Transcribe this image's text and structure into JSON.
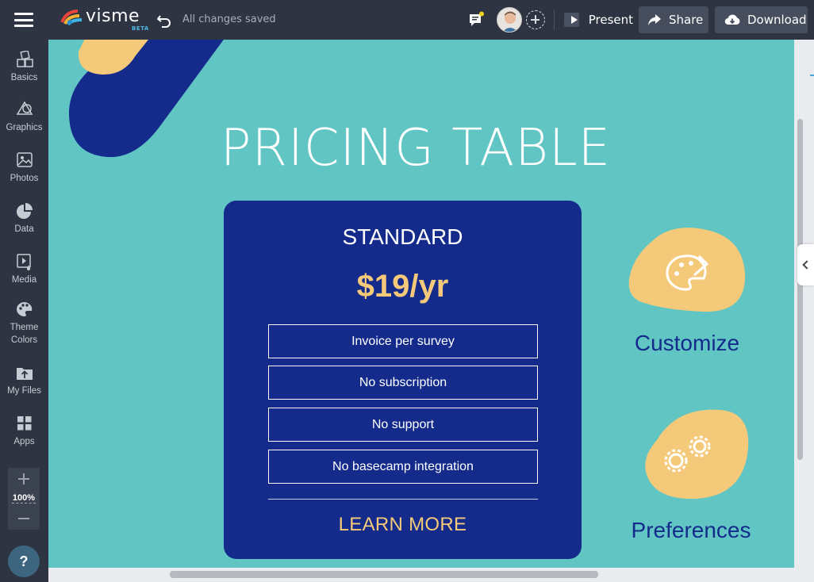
{
  "app": {
    "logo_text": "visme",
    "logo_badge": "BETA",
    "save_status": "All changes saved"
  },
  "header": {
    "present_label": "Present",
    "share_label": "Share",
    "download_label": "Download"
  },
  "sidebar": {
    "items": [
      {
        "label": "Basics",
        "icon": "blocks-icon"
      },
      {
        "label": "Graphics",
        "icon": "shapes-icon"
      },
      {
        "label": "Photos",
        "icon": "image-icon"
      },
      {
        "label": "Data",
        "icon": "pie-chart-icon"
      },
      {
        "label": "Media",
        "icon": "media-icon"
      },
      {
        "label": "Theme Colors",
        "icon": "palette-icon"
      },
      {
        "label": "My Files",
        "icon": "upload-icon"
      },
      {
        "label": "Apps",
        "icon": "grid-icon"
      }
    ],
    "zoom": "100%",
    "help_label": "?"
  },
  "canvas": {
    "title": "PRICING TABLE",
    "plan": {
      "name": "STANDARD",
      "price": "$19/yr",
      "features": [
        "Invoice per survey",
        "No subscription",
        "No support",
        "No basecamp integration"
      ],
      "cta": "LEARN MORE"
    },
    "side_items": [
      {
        "label": "Customize",
        "icon": "palette-icon"
      },
      {
        "label": "Preferences",
        "icon": "gears-icon"
      }
    ]
  },
  "colors": {
    "canvas_bg": "#61c6c3",
    "navy": "#142b8c",
    "gold": "#f5c97a",
    "chrome": "#2e3441"
  }
}
